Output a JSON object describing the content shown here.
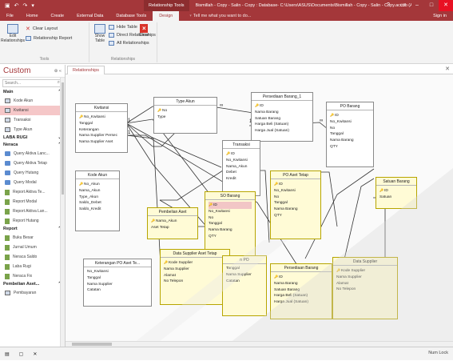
{
  "titlebar": {
    "quick_access": [
      "▣",
      "↶",
      "↷",
      "▾"
    ],
    "context_tab": "Relationship Tools",
    "document": "Bismillah - Copy - Salin - Copy : Database- C:\\Users\\ASUS\\Documents\\Bismillah - Copy - Salin - Copy.accdb (Access 2007 - 2...",
    "help": "?",
    "minimize": "–",
    "maximize": "□",
    "close": "✕"
  },
  "tabs": [
    "File",
    "Home",
    "Create",
    "External Data",
    "Database Tools",
    "Design"
  ],
  "active_tab": "Design",
  "tell_me": "♀ Tell me what you want to do...",
  "sign_in": "Sign in",
  "ribbon": {
    "tools": {
      "edit_relationships": "Edit\nRelationships",
      "clear_layout": "Clear Layout",
      "relationship_report": "Relationship Report",
      "label": "Tools"
    },
    "relationships": {
      "show_table": "Show\nTable",
      "hide_table": "Hide Table",
      "direct_relationships": "Direct Relationships",
      "all_relationships": "All Relationships",
      "close": "Close",
      "label": "Relationships"
    }
  },
  "nav": {
    "title": "Custom",
    "header_icons": "⊛ «",
    "search_placeholder": "Search...",
    "groups": [
      {
        "name": "Main",
        "chev": "⌃",
        "items": [
          {
            "label": "Kode Akun",
            "kind": "table",
            "selected": false
          },
          {
            "label": "Kwitansi",
            "kind": "table",
            "selected": true
          },
          {
            "label": "Transaksi",
            "kind": "table",
            "selected": false
          },
          {
            "label": "Type Akun",
            "kind": "table",
            "selected": false
          }
        ]
      },
      {
        "name": "LABA RUGI",
        "chev": "⌄",
        "items": []
      },
      {
        "name": "Neraca",
        "chev": "⌃",
        "items": [
          {
            "label": "Query Aktiva Lanc...",
            "kind": "query",
            "selected": false
          },
          {
            "label": "Query Aktiva Tetap",
            "kind": "query",
            "selected": false
          },
          {
            "label": "Query Hutang",
            "kind": "query",
            "selected": false
          },
          {
            "label": "Query Modal",
            "kind": "query",
            "selected": false
          },
          {
            "label": "Report Aktiva Te...",
            "kind": "report",
            "selected": false
          },
          {
            "label": "Report Modal",
            "kind": "report",
            "selected": false
          },
          {
            "label": "Report Aktiva Lan...",
            "kind": "report",
            "selected": false
          },
          {
            "label": "Report Hutang",
            "kind": "report",
            "selected": false
          }
        ]
      },
      {
        "name": "Report",
        "chev": "⌃",
        "items": [
          {
            "label": "Buku Besar",
            "kind": "report",
            "selected": false
          },
          {
            "label": "Jurnal Umum",
            "kind": "report",
            "selected": false
          },
          {
            "label": "Neraca Saldo",
            "kind": "report",
            "selected": false
          },
          {
            "label": "Laba Rugi",
            "kind": "report",
            "selected": false
          },
          {
            "label": "Neraca Fix",
            "kind": "report",
            "selected": false
          }
        ]
      },
      {
        "name": "Pembelian Aset...",
        "chev": "⌃",
        "items": [
          {
            "label": "Pembayaran",
            "kind": "table",
            "selected": false
          }
        ]
      }
    ]
  },
  "doc_tab": "Relationships",
  "doc_tab_close": "✕",
  "tables": [
    {
      "name": "kwitansi",
      "title": "Kwitansi",
      "fields": [
        {
          "label": "No_Kwitansi",
          "pk": true
        },
        {
          "label": "Tanggal",
          "pk": false
        },
        {
          "label": "Keterangan",
          "pk": false
        },
        {
          "label": "Nama Supplier Persec",
          "pk": false
        },
        {
          "label": "Nama Supplier Aset",
          "pk": false
        }
      ]
    },
    {
      "name": "type-akun",
      "title": "Type Akun",
      "fields": [
        {
          "label": "No",
          "pk": true
        },
        {
          "label": "Type",
          "pk": false
        }
      ]
    },
    {
      "name": "persediaan-barang-1",
      "title": "Persediaan Barang_1",
      "fields": [
        {
          "label": "ID",
          "pk": true
        },
        {
          "label": "Nama Barang",
          "pk": false
        },
        {
          "label": "Satuan Barang",
          "pk": false
        },
        {
          "label": "Harga Beli (Satuan)",
          "pk": false
        },
        {
          "label": "Harga Jual (Satuan)",
          "pk": false
        }
      ]
    },
    {
      "name": "po-barang",
      "title": "PO Barang",
      "fields": [
        {
          "label": "ID",
          "pk": true
        },
        {
          "label": "No_Kwitansi",
          "pk": false
        },
        {
          "label": "No",
          "pk": false
        },
        {
          "label": "Tanggal",
          "pk": false
        },
        {
          "label": "Nama Barang",
          "pk": false
        },
        {
          "label": "QTY",
          "pk": false
        }
      ]
    },
    {
      "name": "transaksi",
      "title": "Transaksi",
      "fields": [
        {
          "label": "ID",
          "pk": true
        },
        {
          "label": "No_Kwitansi",
          "pk": false
        },
        {
          "label": "Nama_Akun",
          "pk": false
        },
        {
          "label": "Debet",
          "pk": false
        },
        {
          "label": "Kredit",
          "pk": false
        }
      ]
    },
    {
      "name": "kode-akun",
      "title": "Kode Akun",
      "fields": [
        {
          "label": "No_Akun",
          "pk": true
        },
        {
          "label": "Nama_Akun",
          "pk": false
        },
        {
          "label": "Type_Akun",
          "pk": false
        },
        {
          "label": "Saldo_Debet",
          "pk": false
        },
        {
          "label": "Saldo_Kredit",
          "pk": false
        }
      ]
    },
    {
      "name": "po-aset-tetap",
      "title": "PO Aset Tetap",
      "fields": [
        {
          "label": "ID",
          "pk": true
        },
        {
          "label": "No_Kwitansi",
          "pk": false
        },
        {
          "label": "No",
          "pk": false
        },
        {
          "label": "Tanggal",
          "pk": false
        },
        {
          "label": "Nama Barang",
          "pk": false
        },
        {
          "label": "QTY",
          "pk": false
        }
      ]
    },
    {
      "name": "satuan-barang",
      "title": "Satuan Barang",
      "fields": [
        {
          "label": "ID",
          "pk": true
        },
        {
          "label": "Satuan",
          "pk": false
        }
      ]
    },
    {
      "name": "pembelian-aset",
      "title": "Pembelian Aset",
      "fields": [
        {
          "label": "Nama_Akun",
          "pk": true
        },
        {
          "label": "Aset Tetap",
          "pk": false
        }
      ]
    },
    {
      "name": "so-barang",
      "title": "SO Barang",
      "fields": [
        {
          "label": "ID",
          "pk": true,
          "sel": true
        },
        {
          "label": "No_Kwitansi",
          "pk": false
        },
        {
          "label": "No",
          "pk": false
        },
        {
          "label": "Tanggal",
          "pk": false
        },
        {
          "label": "Nama Barang",
          "pk": false
        },
        {
          "label": "QTY",
          "pk": false
        }
      ]
    },
    {
      "name": "keterangan-po-aset",
      "title": "Keterangan PO Aset Te...",
      "fields": [
        {
          "label": "No_Kwitansi",
          "pk": false
        },
        {
          "label": "Tanggal",
          "pk": false
        },
        {
          "label": "Nama Supplier",
          "pk": false
        },
        {
          "label": "Catatan",
          "pk": false
        }
      ]
    },
    {
      "name": "data-supplier-aset-tetap",
      "title": "Data Supplier Aset Tetap",
      "fields": [
        {
          "label": "Kode Supplier",
          "pk": true
        },
        {
          "label": "Nama Supplier",
          "pk": false
        },
        {
          "label": "Alamat",
          "pk": false
        },
        {
          "label": "No Telepon",
          "pk": false
        }
      ]
    },
    {
      "name": "keterangan-po",
      "title": "n PO",
      "fields": [
        {
          "label": "Tanggal",
          "pk": false
        },
        {
          "label": "Nama Supplier",
          "pk": false
        },
        {
          "label": "Catatan",
          "pk": false
        }
      ]
    },
    {
      "name": "persediaan-barang",
      "title": "Persediaan Barang",
      "fields": [
        {
          "label": "ID",
          "pk": true
        },
        {
          "label": "Nama Barang",
          "pk": false
        },
        {
          "label": "Satuan Barang",
          "pk": false
        },
        {
          "label": "Harga Beli (Satuan)",
          "pk": false
        },
        {
          "label": "Harga Jual (Satuan)",
          "pk": false
        }
      ]
    },
    {
      "name": "data-supplier",
      "title": "Data Supplier",
      "fields": [
        {
          "label": "Kode Supplier",
          "pk": true
        },
        {
          "label": "Nama Supplier",
          "pk": false
        },
        {
          "label": "Alamat",
          "pk": false
        },
        {
          "label": "No Telepon",
          "pk": false
        }
      ]
    }
  ],
  "status": {
    "num_lock": "Num Lock"
  },
  "colors": {
    "accent": "#a4373a",
    "selected_row": "#f5c7c8"
  }
}
